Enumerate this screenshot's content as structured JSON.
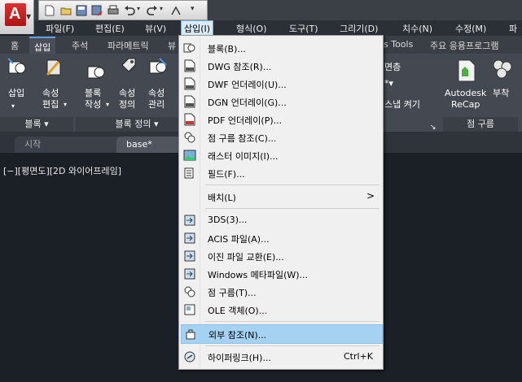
{
  "app": {
    "logo_letter": "A",
    "brand_color": "#c8181e"
  },
  "menubar": {
    "items": [
      "파일(F)",
      "편집(E)",
      "뷰(V)",
      "삽입(I)",
      "형식(O)",
      "도구(T)",
      "그리기(D)",
      "치수(N)",
      "수정(M)",
      "파"
    ],
    "active": "삽입(I)"
  },
  "ribbon_tabs": {
    "items": [
      "홈",
      "삽입",
      "주석",
      "파라메트릭",
      "뷰",
      "s Tools",
      "주요 응용프로그램"
    ],
    "active": "삽입"
  },
  "ribbon": {
    "buttons": [
      {
        "label1": "삽입",
        "label2": "",
        "icon": "insert-block-icon"
      },
      {
        "label1": "속성",
        "label2": "편집",
        "icon": "edit-attribute-icon"
      },
      {
        "label1": "블록",
        "label2": "작성",
        "icon": "create-block-icon"
      },
      {
        "label1": "속성",
        "label2": "정의",
        "icon": "define-attribute-icon"
      },
      {
        "label1": "속성",
        "label2": "관리",
        "icon": "manage-attribute-icon"
      }
    ],
    "right_frag1": "면층",
    "right_frag2": "스냅 켜기",
    "recap_label1": "Autodesk",
    "recap_label2": "ReCap",
    "attach_label": "부착",
    "panels": [
      "블록",
      "블록 정의",
      "점 구름"
    ]
  },
  "file_tabs": [
    "시작",
    "base*"
  ],
  "viewport_label": "[−][평면도][2D 와이어프레임]",
  "dropdown": {
    "items": [
      {
        "label": "블록(B)...",
        "icon": "block-icon"
      },
      {
        "label": "DWG 참조(R)...",
        "icon": "dwg-file-icon"
      },
      {
        "label": "DWF 언더레이(U)...",
        "icon": "dwf-file-icon"
      },
      {
        "label": "DGN 언더레이(G)...",
        "icon": "dgn-file-icon"
      },
      {
        "label": "PDF 언더레이(P)...",
        "icon": "pdf-file-icon"
      },
      {
        "label": "점 구름 참조(C)...",
        "icon": "point-cloud-icon"
      },
      {
        "label": "래스터 이미지(I)...",
        "icon": "raster-image-icon"
      },
      {
        "label": "필드(F)...",
        "icon": "field-icon"
      },
      {
        "label": "배치(L)",
        "icon": "",
        "submenu": ">"
      },
      {
        "label": "3DS(3)...",
        "icon": "3ds-import-icon"
      },
      {
        "label": "ACIS 파일(A)...",
        "icon": "acis-import-icon"
      },
      {
        "label": "이진 파일 교환(E)...",
        "icon": "binary-exchange-icon"
      },
      {
        "label": "Windows 메타파일(W)...",
        "icon": "metafile-icon"
      },
      {
        "label": "점 구름(T)...",
        "icon": "point-cloud-attach-icon"
      },
      {
        "label": "OLE 객체(O)...",
        "icon": "ole-object-icon"
      },
      {
        "label": "외부 참조(N)...",
        "icon": "external-reference-icon"
      },
      {
        "label": "하이퍼링크(H)...",
        "icon": "hyperlink-icon",
        "shortcut": "Ctrl+K"
      }
    ],
    "highlighted": "외부 참조(N)...",
    "highlight_color": "#a6d2f2"
  }
}
